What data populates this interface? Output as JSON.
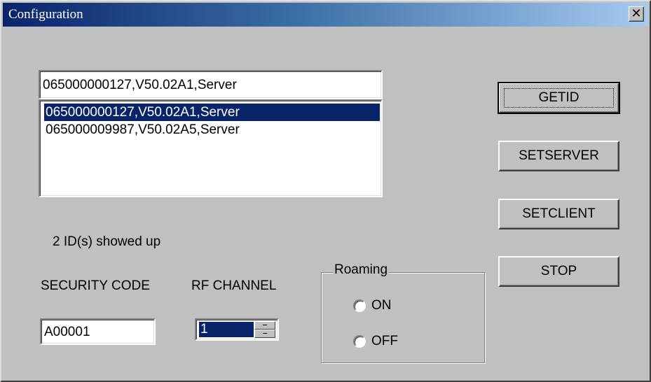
{
  "window": {
    "title": "Configuration",
    "close_glyph": "✕"
  },
  "id_combo": {
    "value": "065000000127,V50.02A1,Server"
  },
  "id_list": {
    "items": [
      "065000000127,V50.02A1,Server",
      "065000009987,V50.02A5,Server"
    ],
    "selected_index": 0
  },
  "status_text": "2 ID(s) showed up",
  "security_code": {
    "label": "SECURITY CODE",
    "value": "A00001"
  },
  "rf_channel": {
    "label": "RF CHANNEL",
    "value": "1"
  },
  "roaming": {
    "label": "Roaming",
    "options": [
      "ON",
      "OFF"
    ]
  },
  "buttons": {
    "getid": "GETID",
    "setserver": "SETSERVER",
    "setclient": "SETCLIENT",
    "stop": "STOP"
  },
  "colors": {
    "face": "#c0c0c0",
    "selection": "#0a246a",
    "title_gradient_start": "#0a246a",
    "title_gradient_end": "#a6caf0"
  }
}
